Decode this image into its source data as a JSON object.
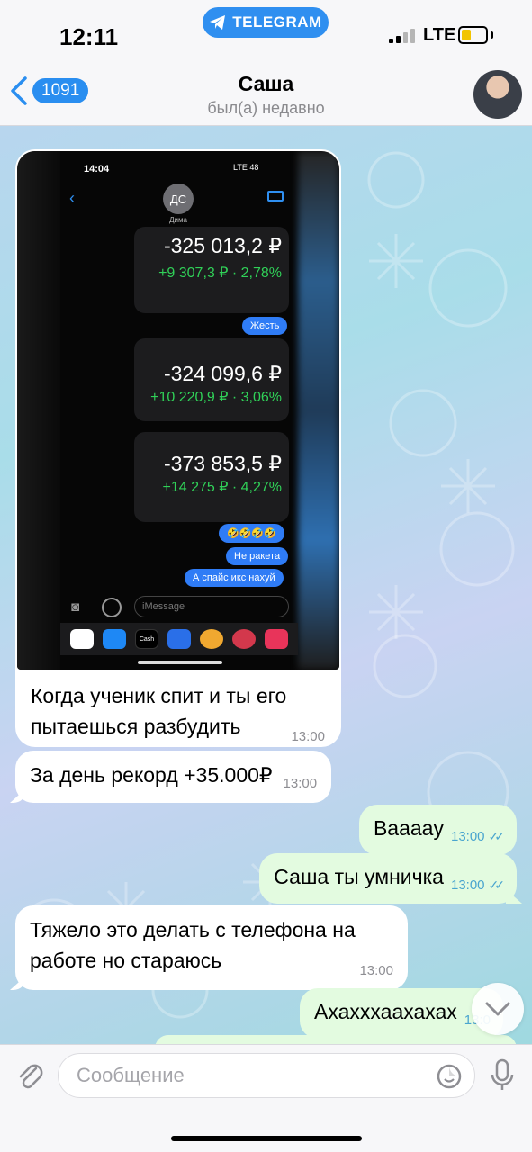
{
  "status_bar": {
    "time": "12:11",
    "app_pill": "TELEGRAM",
    "network": "LTE"
  },
  "header": {
    "unread_count": "1091",
    "name": "Саша",
    "last_seen": "был(а) недавно"
  },
  "photo": {
    "phone_time": "14:04",
    "phone_network": "LTE 48",
    "contact_initials": "ДС",
    "contact_name": "Дима",
    "cards": [
      {
        "amount": "-325 013,2 ₽",
        "change": "+9 307,3 ₽ · 2,78%"
      },
      {
        "amount": "-324 099,6 ₽",
        "change": "+10 220,9 ₽ · 3,06%"
      },
      {
        "amount": "-373 853,5 ₽",
        "change": "+14 275 ₽ · 4,27%"
      }
    ],
    "sent_messages": [
      "Жесть",
      "🤣🤣🤣🤣",
      "Не ракета",
      "А спайс икс нахуй"
    ],
    "input_placeholder": "iMessage",
    "cash_label": "Cash"
  },
  "messages": [
    {
      "direction": "in",
      "text": "Когда ученик спит и ты его пытаешься разбудить",
      "time": "13:00"
    },
    {
      "direction": "in",
      "text": "За день рекорд +35.000₽",
      "time": "13:00"
    },
    {
      "direction": "out",
      "text": "Вааааy",
      "time": "13:00"
    },
    {
      "direction": "out",
      "text": "Саша ты умничка",
      "time": "13:00"
    },
    {
      "direction": "in",
      "text": "Тяжело это делать с телефона на работе но стараюсь",
      "time": "13:00"
    },
    {
      "direction": "out",
      "text": "Ахахххаахахах",
      "time": "13:0"
    }
  ],
  "composer": {
    "placeholder": "Сообщение"
  },
  "colors": {
    "accent": "#2a8ef0",
    "outgoing_bubble": "#e3fbe0",
    "incoming_bubble": "#ffffff",
    "gain_green": "#30d158"
  }
}
